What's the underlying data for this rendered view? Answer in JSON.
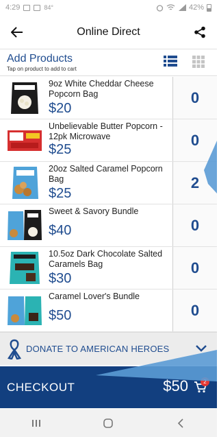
{
  "status_bar": {
    "time": "4:29",
    "temperature": "84°",
    "battery": "42%"
  },
  "app_bar": {
    "title": "Online Direct",
    "back_icon": "arrow-back-icon",
    "share_icon": "share-icon"
  },
  "section": {
    "title": "Add Products",
    "hint": "Tap on product to add to cart",
    "list_view_icon": "list-view-icon",
    "grid_view_icon": "grid-view-icon"
  },
  "products": [
    {
      "name": "9oz White Cheddar Cheese Popcorn Bag",
      "price": "$20",
      "qty": "0"
    },
    {
      "name": "Unbelievable Butter Popcorn - 12pk Microwave",
      "price": "$25",
      "qty": "0"
    },
    {
      "name": "20oz Salted Caramel Popcorn Bag",
      "price": "$25",
      "qty": "2"
    },
    {
      "name": "Sweet & Savory Bundle",
      "price": "$40",
      "qty": "0"
    },
    {
      "name": "10.5oz Dark Chocolate Salted Caramels Bag",
      "price": "$30",
      "qty": "0"
    },
    {
      "name": "Caramel Lover's Bundle",
      "price": "$50",
      "qty": "0"
    }
  ],
  "donate": {
    "label": "DONATE TO AMERICAN HEROES",
    "icon": "ribbon-icon"
  },
  "checkout": {
    "label": "CHECKOUT",
    "total": "$50",
    "cart_count": "2"
  },
  "colors": {
    "brand_blue": "#1f4c8f",
    "checkout_bg": "#123f7f",
    "callout_blue": "#5b9bd5"
  }
}
